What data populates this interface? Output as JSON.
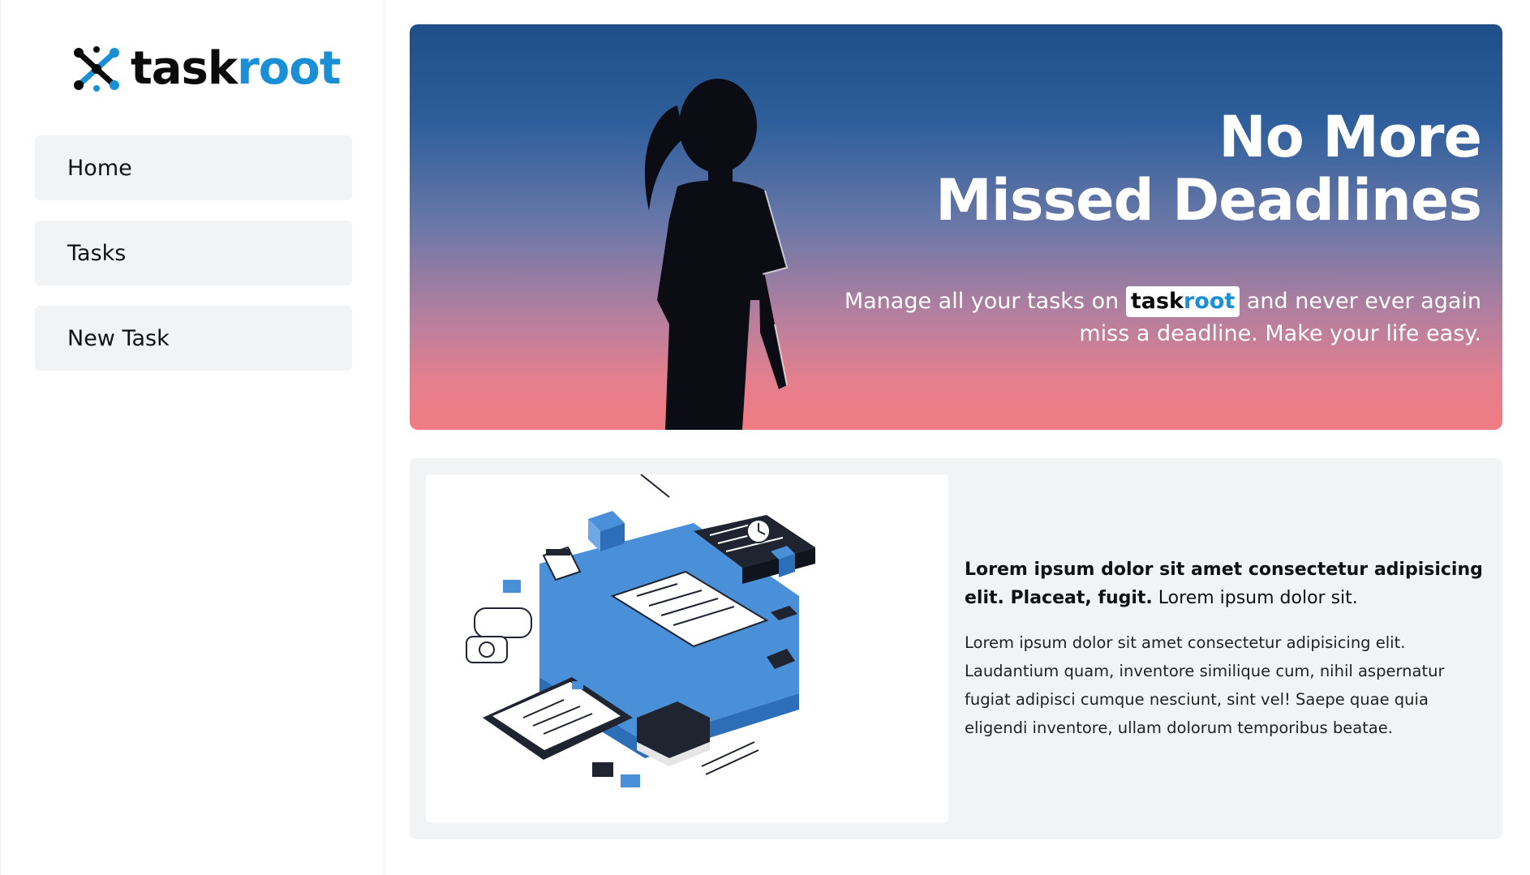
{
  "brand": {
    "name_part1": "task",
    "name_part2": "root",
    "color_dark": "#0b0b0b",
    "color_accent": "#1a8fd6",
    "icon": "taskroot-logo-icon"
  },
  "sidebar": {
    "items": [
      {
        "label": "Home"
      },
      {
        "label": "Tasks"
      },
      {
        "label": "New Task"
      }
    ]
  },
  "hero": {
    "title_line1": "No More",
    "title_line2": "Missed Deadlines",
    "subtitle_before": "Manage all your tasks on",
    "subtitle_brand_part1": "task",
    "subtitle_brand_part2": "root",
    "subtitle_after": "and never ever again miss a deadline. Make your life easy.",
    "image": "girl-silhouette-icon",
    "gradient_top": "#1f4f87",
    "gradient_bottom": "#f07b82"
  },
  "feature": {
    "image": "task-management-illustration-icon",
    "lead_bold": "Lorem ipsum dolor sit amet consectetur adipisicing elit. Placeat, fugit.",
    "lead_rest": "Lorem ipsum dolor sit.",
    "body": "Lorem ipsum dolor sit amet consectetur adipisicing elit. Laudantium quam, inventore similique cum, nihil aspernatur fugiat adipisci cumque nesciunt, sint vel! Saepe quae quia eligendi inventore, ullam dolorum temporibus beatae."
  }
}
